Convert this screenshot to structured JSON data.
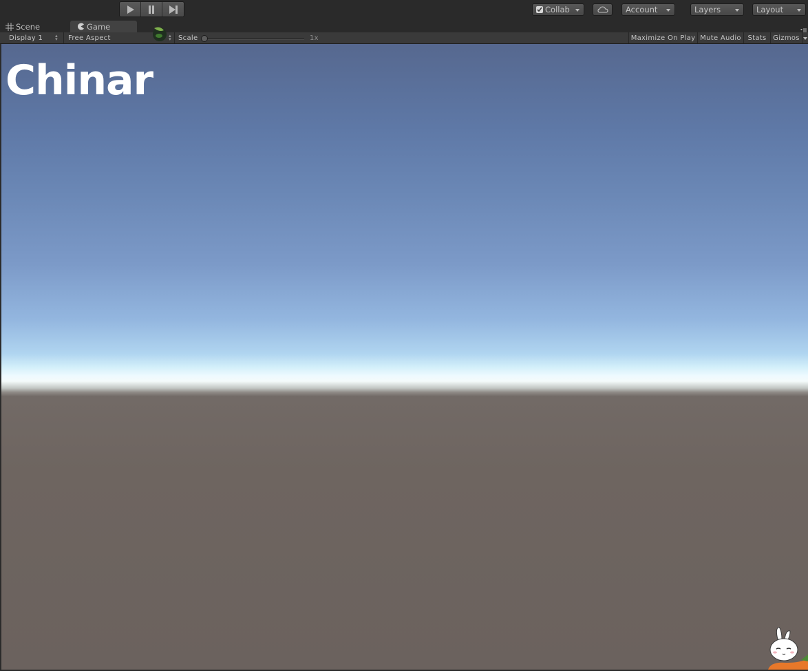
{
  "toolbar": {
    "play_icon": "play-icon",
    "pause_icon": "pause-icon",
    "step_icon": "step-icon",
    "collab_label": "Collab",
    "cloud_icon": "cloud-icon",
    "account_label": "Account",
    "layers_label": "Layers",
    "layout_label": "Layout"
  },
  "tabs": [
    {
      "label": "Scene",
      "icon": "grid-icon"
    },
    {
      "label": "Game",
      "icon": "pacman-icon"
    }
  ],
  "game_toolbar": {
    "display_value": "Display 1",
    "aspect_value": "Free Aspect",
    "scale_label": "Scale",
    "scale_value": "1x",
    "scale_slider_level": 0,
    "maximize_label": "Maximize On Play",
    "mute_label": "Mute Audio",
    "stats_label": "Stats",
    "gizmos_label": "Gizmos"
  },
  "viewport": {
    "title_text": "Chinar",
    "mascot_icon": "bunny-mascot-icon"
  },
  "colors": {
    "sky_top": "#56688f",
    "horizon": "#eefaff",
    "ground": "#6b625e"
  }
}
